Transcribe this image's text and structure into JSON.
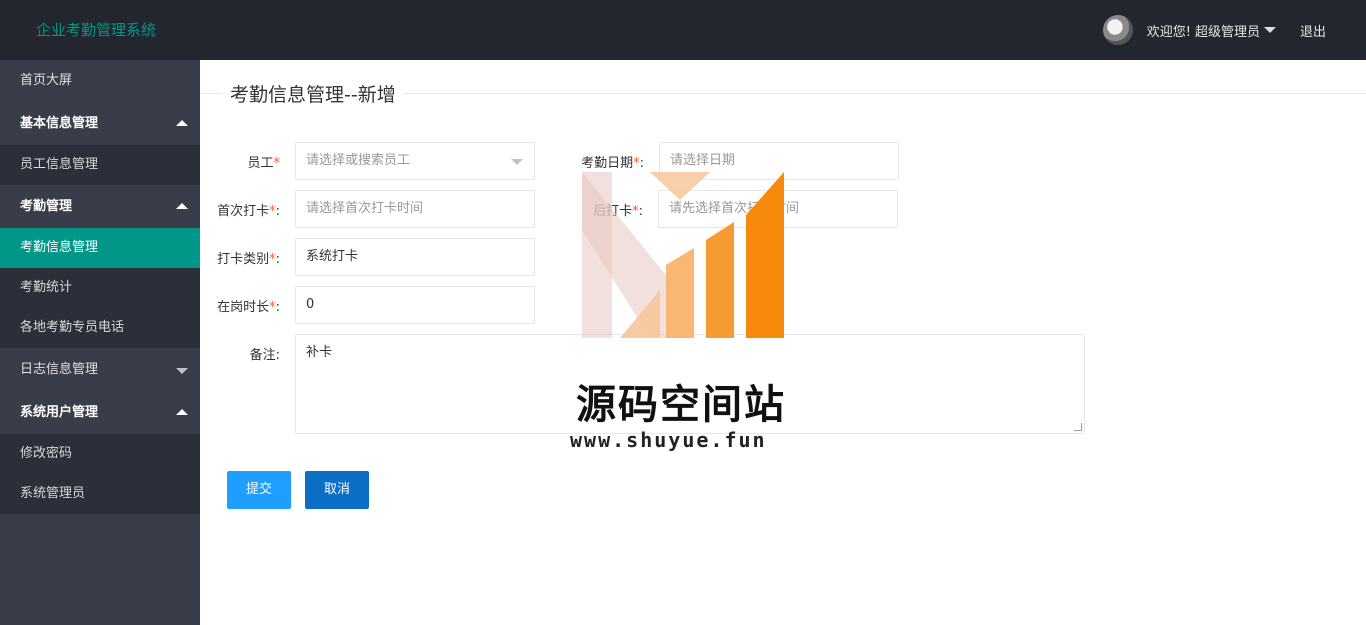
{
  "header": {
    "brand": "企业考勤管理系统",
    "welcome": "欢迎您!",
    "username": "超级管理员",
    "logout": "退出"
  },
  "sidebar": {
    "home": "首页大屏",
    "groups": [
      {
        "label": "基本信息管理",
        "expanded": true,
        "items": [
          "员工信息管理"
        ]
      },
      {
        "label": "考勤管理",
        "expanded": true,
        "items": [
          "考勤信息管理",
          "考勤统计",
          "各地考勤专员电话"
        ]
      },
      {
        "label": "日志信息管理",
        "expanded": false,
        "items": []
      },
      {
        "label": "系统用户管理",
        "expanded": true,
        "items": [
          "修改密码",
          "系统管理员"
        ]
      }
    ],
    "active_item": "考勤信息管理"
  },
  "page": {
    "title": "考勤信息管理--新增"
  },
  "form": {
    "employee": {
      "label": "员工",
      "placeholder": "请选择或搜索员工"
    },
    "date": {
      "label": "考勤日期",
      "placeholder": "请选择日期"
    },
    "first_punch": {
      "label": "首次打卡",
      "placeholder": "请选择首次打卡时间"
    },
    "last_punch": {
      "label": "后打卡",
      "placeholder": "请先选择首次打卡时间"
    },
    "punch_type": {
      "label": "打卡类别",
      "value": "系统打卡"
    },
    "duration": {
      "label": "在岗时长",
      "value": "0"
    },
    "remark": {
      "label": "备注",
      "value": "补卡"
    },
    "required_mark": "*",
    "colon": ":"
  },
  "buttons": {
    "submit": "提交",
    "cancel": "取消"
  },
  "watermark": {
    "title": "源码空间站",
    "url": "www.shuyue.fun"
  },
  "colors": {
    "topbar": "#23262e",
    "sidebar": "#393d49",
    "active": "#009688",
    "primary": "#1e9fff",
    "required": "#ff5722"
  }
}
